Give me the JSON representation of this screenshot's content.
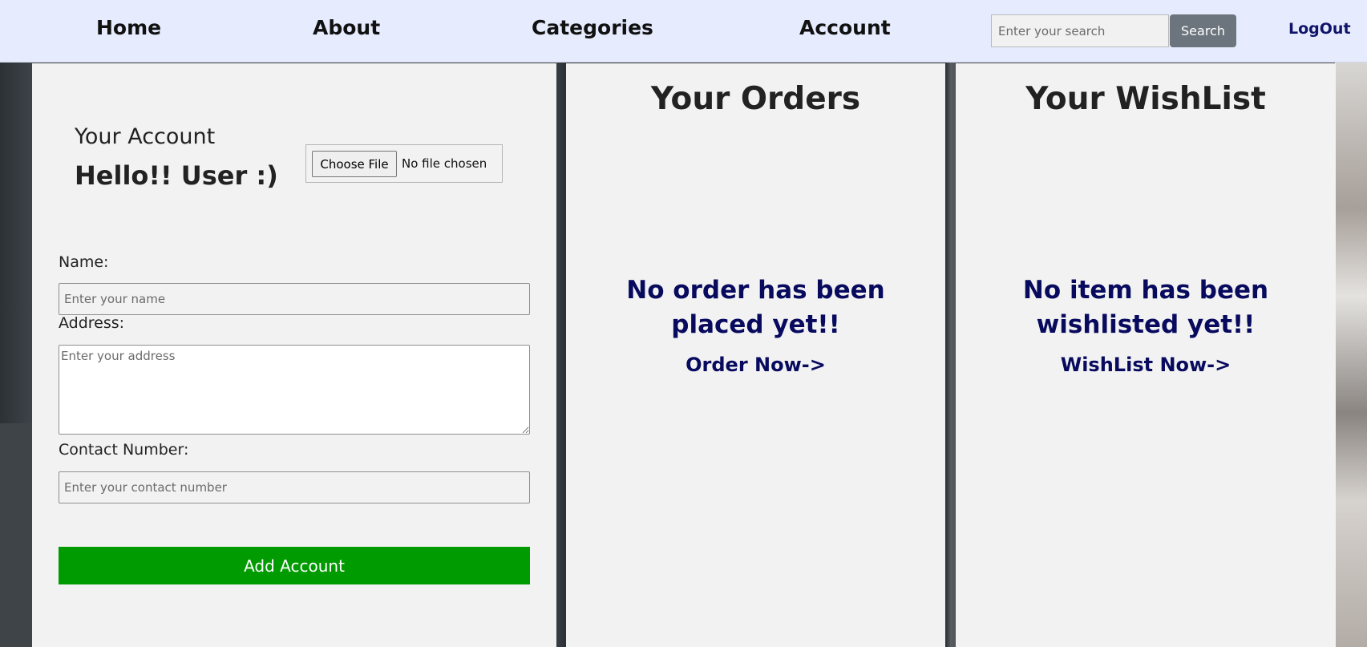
{
  "nav": {
    "home": "Home",
    "about": "About",
    "categories": "Categories",
    "account": "Account",
    "search_placeholder": "Enter your search",
    "search_button": "Search",
    "logout": "LogOut"
  },
  "account_panel": {
    "title": "Your Account",
    "greeting": "Hello!! User :)",
    "file_button": "Choose File",
    "file_status": "No file chosen",
    "name_label": "Name:",
    "name_placeholder": "Enter your name",
    "address_label": "Address:",
    "address_placeholder": "Enter your address",
    "contact_label": "Contact Number:",
    "contact_placeholder": "Enter your contact number",
    "submit_label": "Add Account"
  },
  "orders_panel": {
    "heading": "Your Orders",
    "empty_line1": "No order has been",
    "empty_line2": "placed yet!!",
    "cta": "Order Now->"
  },
  "wishlist_panel": {
    "heading": "Your WishList",
    "empty_line1": "No item has been",
    "empty_line2": "wishlisted yet!!",
    "cta": "WishList Now->"
  },
  "colors": {
    "navbar_bg": "#e6ecfd",
    "panel_bg": "#f2f2f2",
    "accent_navy": "#080a5e",
    "submit_green": "#009b00",
    "search_button_gray": "#6c757d"
  }
}
